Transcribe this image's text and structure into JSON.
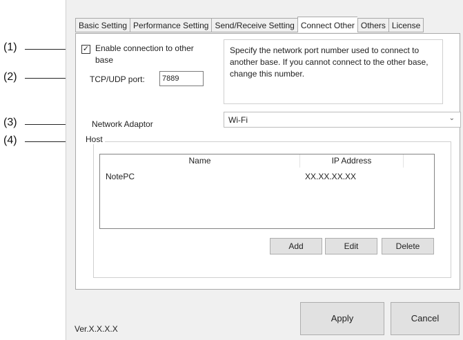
{
  "callouts": {
    "c1": "(1)",
    "c2": "(2)",
    "c3": "(3)",
    "c4": "(4)"
  },
  "tabs": [
    {
      "label": "Basic Setting"
    },
    {
      "label": "Performance Setting"
    },
    {
      "label": "Send/Receive Setting"
    },
    {
      "label": "Connect Other"
    },
    {
      "label": "Others"
    },
    {
      "label": "License"
    }
  ],
  "active_tab": "Connect Other",
  "connect": {
    "enable_label_line1": "Enable connection to other",
    "enable_label_line2": "base",
    "enable_checked": true,
    "checkbox_glyph": "✓",
    "port_label": "TCP/UDP port:",
    "port_value": "7889",
    "description": "Specify the network port number used to connect to another base. If you cannot connect to the other base, change this number.",
    "adapter_label": "Network Adaptor",
    "adapter_value": "Wi-Fi",
    "host_label": "Host"
  },
  "host_table": {
    "columns": [
      "Name",
      "IP Address"
    ],
    "rows": [
      {
        "name": "NotePC",
        "ip": "XX.XX.XX.XX"
      }
    ]
  },
  "buttons": {
    "add": "Add",
    "edit": "Edit",
    "delete": "Delete",
    "apply": "Apply",
    "cancel": "Cancel"
  },
  "version": "Ver.X.X.X.X"
}
